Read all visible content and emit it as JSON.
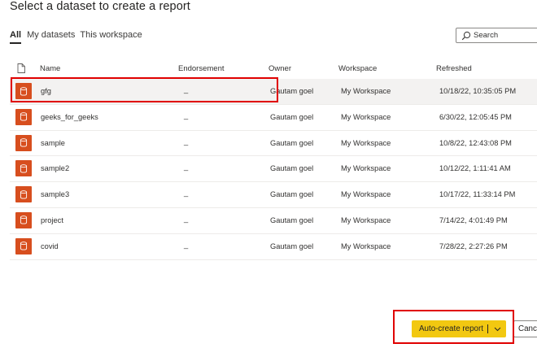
{
  "dialog": {
    "title": "Select a dataset to create a report"
  },
  "tabs": [
    {
      "label": "All",
      "active": true
    },
    {
      "label": "My datasets",
      "active": false
    },
    {
      "label": "This workspace",
      "active": false
    }
  ],
  "search": {
    "placeholder": "Search"
  },
  "table": {
    "columns": [
      "Name",
      "Endorsement",
      "Owner",
      "Workspace",
      "Refreshed"
    ],
    "rows": [
      {
        "name": "gfg",
        "endorsement": "_",
        "owner": "Gautam goel",
        "workspace": "My Workspace",
        "refreshed": "10/18/22, 10:35:05 PM",
        "selected": true
      },
      {
        "name": "geeks_for_geeks",
        "endorsement": "_",
        "owner": "Gautam goel",
        "workspace": "My Workspace",
        "refreshed": "6/30/22, 12:05:45 PM"
      },
      {
        "name": "sample",
        "endorsement": "_",
        "owner": "Gautam goel",
        "workspace": "My Workspace",
        "refreshed": "10/8/22, 12:43:08 PM"
      },
      {
        "name": "sample2",
        "endorsement": "_",
        "owner": "Gautam goel",
        "workspace": "My Workspace",
        "refreshed": "10/12/22, 1:11:41 AM"
      },
      {
        "name": "sample3",
        "endorsement": "_",
        "owner": "Gautam goel",
        "workspace": "My Workspace",
        "refreshed": "10/17/22, 11:33:14 PM"
      },
      {
        "name": "project",
        "endorsement": "_",
        "owner": "Gautam goel",
        "workspace": "My Workspace",
        "refreshed": "7/14/22, 4:01:49 PM"
      },
      {
        "name": "covid",
        "endorsement": "_",
        "owner": "Gautam goel",
        "workspace": "My Workspace",
        "refreshed": "7/28/22, 2:27:26 PM"
      }
    ]
  },
  "footer": {
    "primary_label": "Auto-create report",
    "cancel_label": "Cancel"
  },
  "colors": {
    "dataset_icon": "#d74e1e",
    "primary_button": "#f2c811",
    "annotation_box": "#e00000"
  }
}
